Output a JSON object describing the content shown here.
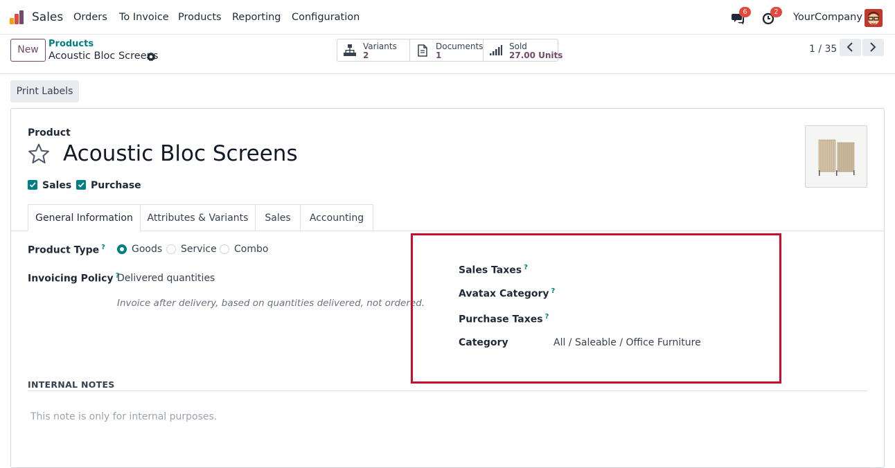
{
  "navbar": {
    "app_name": "Sales",
    "menu": [
      "Orders",
      "To Invoice",
      "Products",
      "Reporting",
      "Configuration"
    ],
    "messages_count": "6",
    "activities_count": "2",
    "company": "YourCompany"
  },
  "control": {
    "new_label": "New",
    "breadcrumb_parent": "Products",
    "breadcrumb_current": "Acoustic Bloc Screens",
    "smart_buttons": [
      {
        "label": "Variants",
        "value": "2",
        "icon": "sitemap-icon"
      },
      {
        "label": "Documents",
        "value": "1",
        "icon": "document-icon"
      },
      {
        "label": "Sold",
        "value": "27.00 Units",
        "icon": "bar-chart-icon"
      }
    ],
    "pager": "1 / 35"
  },
  "status_bar": {
    "print_labels": "Print Labels"
  },
  "form": {
    "product_label": "Product",
    "name": "Acoustic Bloc Screens",
    "sales_label": "Sales",
    "purchase_label": "Purchase",
    "tabs": [
      "General Information",
      "Attributes & Variants",
      "Sales",
      "Accounting"
    ],
    "product_type_label": "Product Type",
    "product_type_options": [
      "Goods",
      "Service",
      "Combo"
    ],
    "product_type_selected": "Goods",
    "invoicing_policy_label": "Invoicing Policy",
    "invoicing_policy_value": "Delivered quantities",
    "invoicing_policy_hint": "Invoice after delivery, based on quantities delivered, not ordered.",
    "help_mark": "?",
    "sales_taxes_label": "Sales Taxes",
    "avatax_category_label": "Avatax Category",
    "purchase_taxes_label": "Purchase Taxes",
    "category_label": "Category",
    "category_value": "All / Saleable / Office Furniture",
    "internal_notes_title": "INTERNAL NOTES",
    "internal_notes_placeholder": "This note is only for internal purposes."
  },
  "colors": {
    "brand": "#714b67",
    "accent": "#017e84",
    "badge": "#e4483c",
    "highlight": "#c8102e"
  }
}
